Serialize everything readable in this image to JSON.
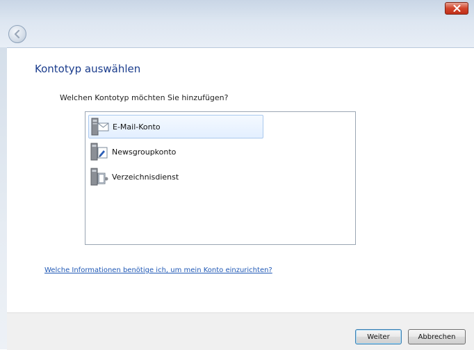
{
  "window": {
    "close_label": "x"
  },
  "page": {
    "title": "Kontotyp auswählen",
    "question": "Welchen Kontotyp möchten Sie hinzufügen?"
  },
  "account_types": [
    {
      "label": "E-Mail-Konto",
      "icon": "email-account-icon",
      "selected": true
    },
    {
      "label": "Newsgroupkonto",
      "icon": "newsgroup-account-icon",
      "selected": false
    },
    {
      "label": "Verzeichnisdienst",
      "icon": "directory-service-icon",
      "selected": false
    }
  ],
  "help_link": "Welche Informationen benötige ich, um mein Konto einzurichten?",
  "buttons": {
    "next": "Weiter",
    "cancel": "Abbrechen"
  },
  "colors": {
    "title": "#1a3c8c",
    "link": "#1f58b5",
    "selection_border": "#a9c8ee",
    "close_button": "#d2442b"
  }
}
